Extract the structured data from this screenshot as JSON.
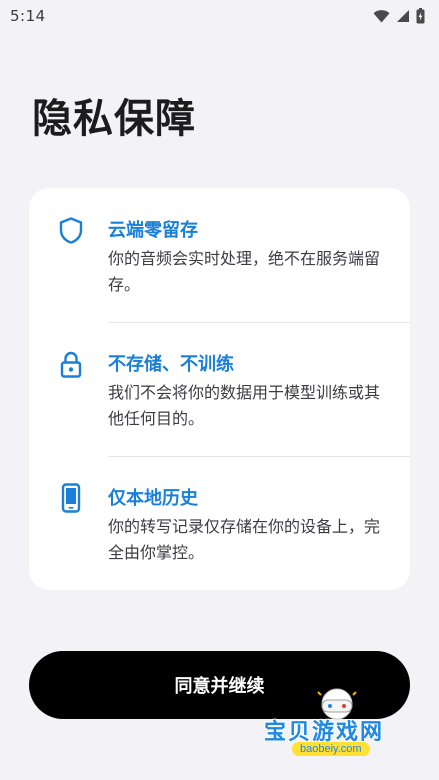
{
  "status_bar": {
    "time": "5:14",
    "icons": [
      "wifi-icon",
      "signal-icon",
      "battery-icon"
    ]
  },
  "page": {
    "title": "隐私保障"
  },
  "features": [
    {
      "icon": "shield-icon",
      "title": "云端零留存",
      "description": "你的音频会实时处理，绝不在服务端留存。"
    },
    {
      "icon": "lock-icon",
      "title": "不存储、不训练",
      "description": "我们不会将你的数据用于模型训练或其他任何目的。"
    },
    {
      "icon": "phone-icon",
      "title": "仅本地历史",
      "description": "你的转写记录仅存储在你的设备上，完全由你掌控。"
    }
  ],
  "actions": {
    "continue_label": "同意并继续"
  },
  "watermark": {
    "text": "宝贝游戏网",
    "url": "baobeiy.com"
  },
  "colors": {
    "accent": "#1a7fd9",
    "background": "#f2f2f7",
    "button": "#000000"
  }
}
